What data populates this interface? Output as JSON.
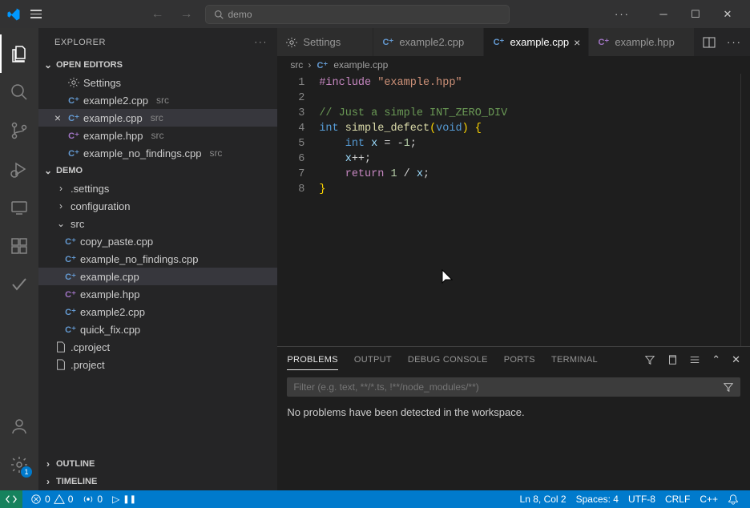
{
  "titlebar": {
    "search_prefix": "demo"
  },
  "explorer": {
    "title": "EXPLORER",
    "open_editors": {
      "label": "OPEN EDITORS",
      "items": [
        {
          "name": "Settings",
          "desc": "",
          "icon": "gear",
          "close": false
        },
        {
          "name": "example2.cpp",
          "desc": "src",
          "icon": "cpp",
          "close": false
        },
        {
          "name": "example.cpp",
          "desc": "src",
          "icon": "cpp",
          "close": true,
          "selected": true
        },
        {
          "name": "example.hpp",
          "desc": "src",
          "icon": "hpp",
          "close": false
        },
        {
          "name": "example_no_findings.cpp",
          "desc": "src",
          "icon": "cpp",
          "close": false
        }
      ]
    },
    "folder": {
      "name": "DEMO",
      "children": [
        {
          "name": ".settings",
          "type": "folder",
          "expanded": false,
          "indent": 1
        },
        {
          "name": "configuration",
          "type": "folder",
          "expanded": false,
          "indent": 1
        },
        {
          "name": "src",
          "type": "folder",
          "expanded": true,
          "indent": 1
        },
        {
          "name": "copy_paste.cpp",
          "type": "file",
          "icon": "cpp",
          "indent": 2
        },
        {
          "name": "example_no_findings.cpp",
          "type": "file",
          "icon": "cpp",
          "indent": 2
        },
        {
          "name": "example.cpp",
          "type": "file",
          "icon": "cpp",
          "indent": 2,
          "selected": true
        },
        {
          "name": "example.hpp",
          "type": "file",
          "icon": "hpp",
          "indent": 2
        },
        {
          "name": "example2.cpp",
          "type": "file",
          "icon": "cpp",
          "indent": 2
        },
        {
          "name": "quick_fix.cpp",
          "type": "file",
          "icon": "cpp",
          "indent": 2
        },
        {
          "name": ".cproject",
          "type": "file",
          "icon": "file",
          "indent": 1
        },
        {
          "name": ".project",
          "type": "file",
          "icon": "file",
          "indent": 1
        }
      ]
    },
    "outline": "OUTLINE",
    "timeline": "TIMELINE"
  },
  "tabs": [
    {
      "label": "Settings",
      "icon": "gear",
      "active": false
    },
    {
      "label": "example2.cpp",
      "icon": "cpp",
      "active": false
    },
    {
      "label": "example.cpp",
      "icon": "cpp",
      "active": true
    },
    {
      "label": "example.hpp",
      "icon": "hpp",
      "active": false
    }
  ],
  "breadcrumb": {
    "root": "src",
    "file": "example.cpp"
  },
  "code": {
    "lines": [
      {
        "n": 1,
        "html": "<span class='tok-pre'>#include</span> <span class='tok-str'>\"example.hpp\"</span>"
      },
      {
        "n": 2,
        "html": ""
      },
      {
        "n": 3,
        "html": "<span class='tok-com'>// Just a simple INT_ZERO_DIV</span>"
      },
      {
        "n": 4,
        "html": "<span class='tok-kw'>int</span> <span class='tok-fn'>simple_defect</span><span class='tok-br'>(</span><span class='tok-typ'>void</span><span class='tok-br'>)</span> <span class='tok-br'>{</span>"
      },
      {
        "n": 5,
        "html": "    <span class='tok-kw'>int</span> <span class='tok-var'>x</span> <span class='tok-op'>=</span> <span class='tok-op'>-</span><span class='tok-num'>1</span><span class='tok-op'>;</span>"
      },
      {
        "n": 6,
        "html": "    <span class='tok-var'>x</span><span class='tok-op'>++;</span>"
      },
      {
        "n": 7,
        "html": "    <span class='tok-pre'>return</span> <span class='tok-num'>1</span> <span class='tok-op'>/</span> <span class='tok-var'>x</span><span class='tok-op'>;</span>"
      },
      {
        "n": 8,
        "html": "<span class='tok-br'>}</span>"
      }
    ]
  },
  "panel": {
    "tabs": [
      "PROBLEMS",
      "OUTPUT",
      "DEBUG CONSOLE",
      "PORTS",
      "TERMINAL"
    ],
    "active_tab": 0,
    "filter_placeholder": "Filter (e.g. text, **/*.ts, !**/node_modules/**)",
    "message": "No problems have been detected in the workspace."
  },
  "statusbar": {
    "errors": "0",
    "warnings": "0",
    "radio": "0",
    "cursor": "Ln 8, Col 2",
    "spaces": "Spaces: 4",
    "encoding": "UTF-8",
    "eol": "CRLF",
    "lang": "C++"
  },
  "settings_badge": "1"
}
